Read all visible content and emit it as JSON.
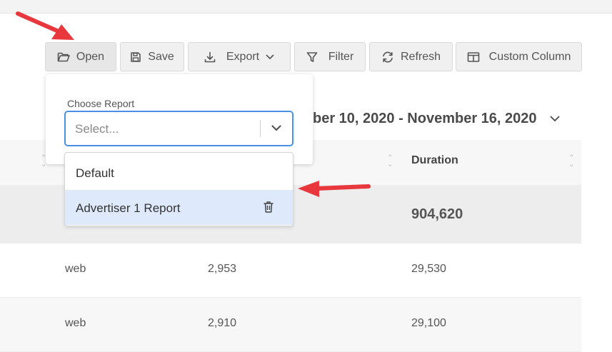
{
  "toolbar": {
    "open_label": "Open",
    "save_label": "Save",
    "export_label": "Export",
    "filter_label": "Filter",
    "refresh_label": "Refresh",
    "custom_column_label": "Custom Column"
  },
  "date_range": "ber 10, 2020 - November 16, 2020",
  "report_picker": {
    "label": "Choose Report",
    "placeholder": "Select...",
    "options": [
      {
        "label": "Default"
      },
      {
        "label": "Advertiser 1 Report",
        "highlighted": true
      }
    ]
  },
  "table": {
    "visible_header": "Duration",
    "total": {
      "duration": "904,620"
    },
    "rows": [
      {
        "platform": "web",
        "count": "2,953",
        "duration": "29,530"
      },
      {
        "platform": "web",
        "count": "2,910",
        "duration": "29,100"
      }
    ]
  },
  "colors": {
    "accent": "#4a90e2",
    "highlight": "#deeafc",
    "annotation_arrow": "#e8383d"
  },
  "icons": {
    "open": "folder-open-icon",
    "save": "floppy-disk-icon",
    "export": "download-icon",
    "filter": "funnel-icon",
    "refresh": "refresh-icon",
    "custom_column": "columns-icon",
    "option_delete": "trash-icon"
  }
}
